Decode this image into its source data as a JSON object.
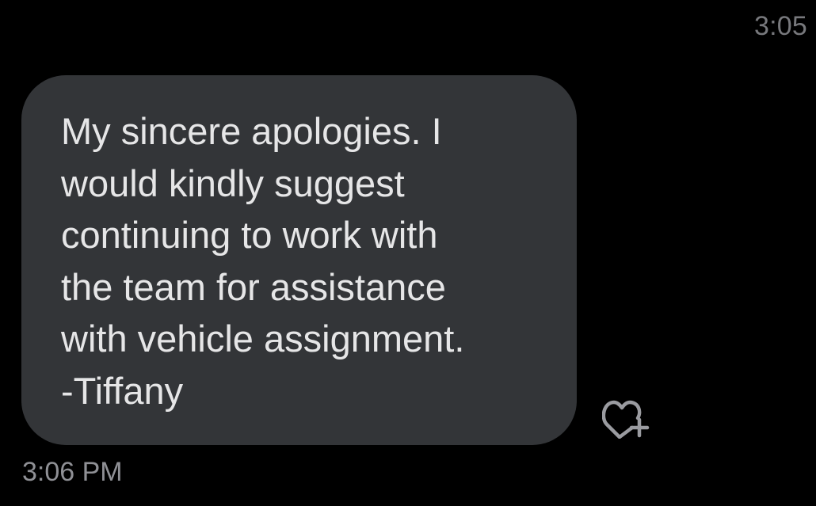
{
  "conversation": {
    "previous_timestamp": "3:05",
    "message": {
      "text": "My sincere apologies. I\nwould kindly suggest\ncontinuing to work with\nthe team for assistance\nwith vehicle assignment.\n-Tiffany",
      "timestamp": "3:06 PM"
    },
    "reaction_button": {
      "icon": "heart-plus-icon"
    }
  },
  "colors": {
    "background": "#000000",
    "bubble": "#333538",
    "text": "#e6e6e7",
    "timestamp": "#8f9095"
  }
}
